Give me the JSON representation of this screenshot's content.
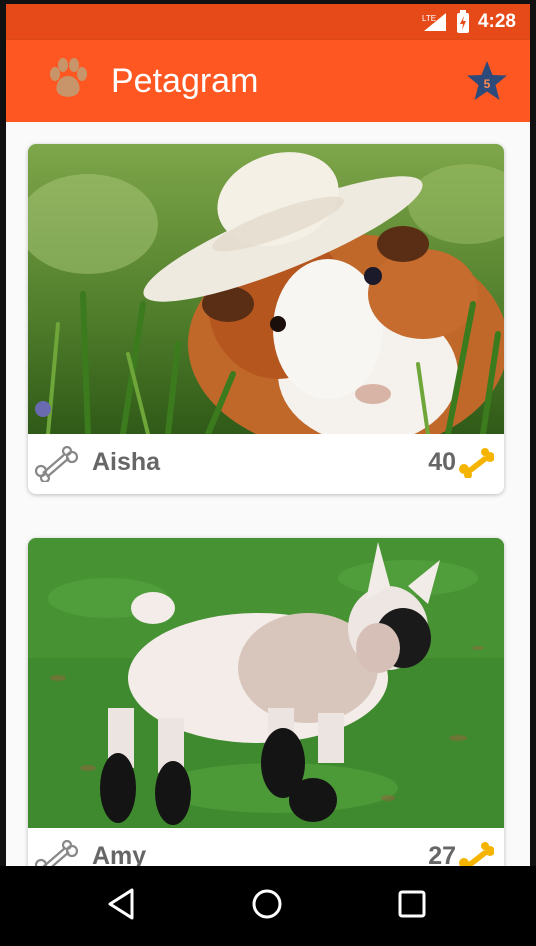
{
  "status_bar": {
    "time": "4:28",
    "network_label": "LTE",
    "icons": [
      "signal-icon",
      "battery-icon"
    ]
  },
  "app_bar": {
    "title": "Petagram",
    "logo_icon": "paw-icon",
    "favorites_icon": "star-five-icon",
    "favorites_badge": "5"
  },
  "pets": [
    {
      "name": "Aisha",
      "likes": "40",
      "photo": "guinea-pig-in-sun-hat"
    },
    {
      "name": "Amy",
      "likes": "27",
      "photo": "baby-goat-on-grass"
    }
  ],
  "nav_bar": {
    "icons": [
      "back-icon",
      "home-icon",
      "recents-icon"
    ]
  },
  "colors": {
    "primary": "#ff5722",
    "primary_dark": "#e64a19",
    "accent_star": "#2c4a7a",
    "bone_gold": "#f4b400"
  }
}
